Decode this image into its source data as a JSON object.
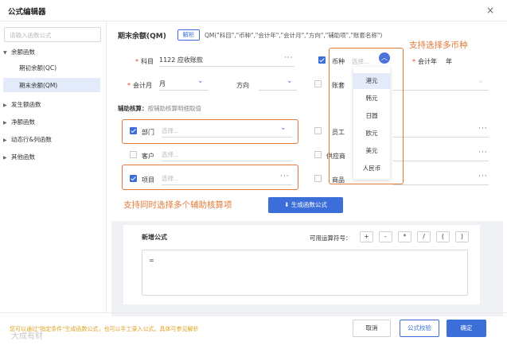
{
  "dialog": {
    "title": "公式编辑器",
    "close": "×"
  },
  "sidebar": {
    "search_placeholder": "请输入函数公式",
    "items": [
      {
        "label": "余额函数",
        "expanded": true
      },
      {
        "label": "期初余额(QC)",
        "child": true
      },
      {
        "label": "期末余额(QM)",
        "child": true,
        "selected": true
      },
      {
        "label": "发生额函数",
        "expanded": false
      },
      {
        "label": "净额函数",
        "expanded": false
      },
      {
        "label": "动态行&列函数",
        "expanded": false
      },
      {
        "label": "其他函数",
        "expanded": false
      }
    ]
  },
  "func": {
    "name": "期末余额(QM)",
    "parse_btn": "解析",
    "signature": "QM(\"科目\",\"币种\",\"会计年\",\"会计月\",\"方向\",\"辅助项\",\"账套名称\")"
  },
  "form": {
    "subject_label": "科目",
    "subject_value": "1122 应收账款",
    "currency_label": "币种",
    "currency_placeholder": "选择...",
    "year_label": "会计年",
    "year_value": "年",
    "month_label": "会计月",
    "month_value": "月",
    "direction_label": "方向",
    "ledger_label": "账套",
    "ellipsis": "···",
    "chevron": "⌄"
  },
  "aux": {
    "title": "辅助核算：",
    "hint": "按辅助核算明细取值",
    "rows": [
      {
        "label": "部门",
        "placeholder": "选择...",
        "checked": true
      },
      {
        "label": "客户",
        "placeholder": "选择...",
        "checked": false
      },
      {
        "label": "项目",
        "placeholder": "选择...",
        "checked": true
      }
    ],
    "right_rows": [
      {
        "label": "员工"
      },
      {
        "label": "供应商"
      },
      {
        "label": "商品"
      }
    ]
  },
  "currency_options": [
    "港元",
    "韩元",
    "日圆",
    "欧元",
    "美元",
    "人民币"
  ],
  "callouts": {
    "multi_currency": "支持选择多币种",
    "multi_aux": "支持同时选择多个辅助核算项"
  },
  "generate_btn": "生成函数公式",
  "formula": {
    "title": "新增公式",
    "ops_label": "可用运算符号：",
    "ops": [
      "+",
      "-",
      "*",
      "/",
      "(",
      ")"
    ],
    "content": "="
  },
  "footer": {
    "hint": "您可以通过\"指定条件\"生成函数公式，也可以手工录入公式。具体可参见解析",
    "cancel": "取消",
    "check": "公式校验",
    "ok": "确定"
  },
  "watermark": "大成有财"
}
